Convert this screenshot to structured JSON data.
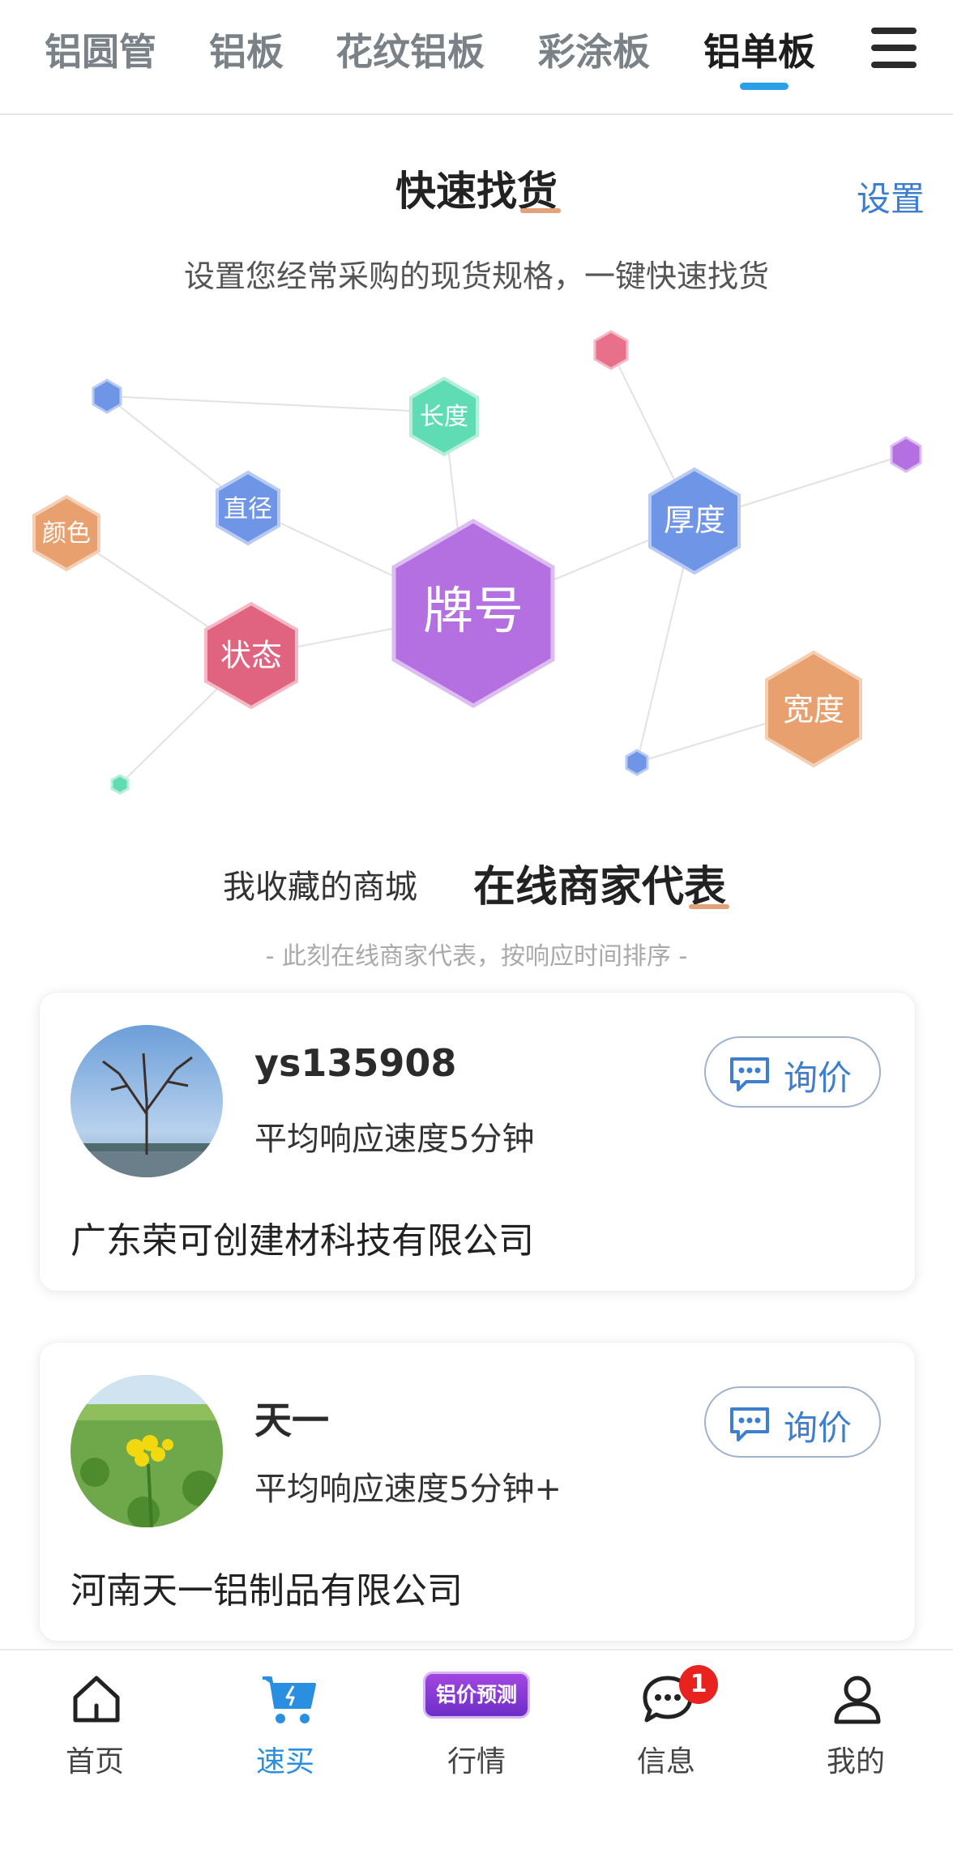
{
  "top_tabs": [
    "铝圆管",
    "铝板",
    "花纹铝板",
    "彩涂板",
    "铝单板"
  ],
  "active_tab_index": 4,
  "quick_find": {
    "title": "快速找货",
    "settings": "设置",
    "subtitle": "设置您经常采购的现货规格，一键快速找货"
  },
  "spec_nodes": [
    {
      "label": "牌号",
      "color": "#b46fe0"
    },
    {
      "label": "厚度",
      "color": "#6f95e6"
    },
    {
      "label": "状态",
      "color": "#e0637f"
    },
    {
      "label": "宽度",
      "color": "#e8a06e"
    },
    {
      "label": "直径",
      "color": "#6f95e6"
    },
    {
      "label": "长度",
      "color": "#5fdcb3"
    },
    {
      "label": "颜色",
      "color": "#e8a06e"
    }
  ],
  "merchants_section": {
    "tab_favorites": "我收藏的商城",
    "tab_online": "在线商家代表",
    "subtitle": "- 此刻在线商家代表，按响应时间排序 -"
  },
  "merchants": [
    {
      "name": "ys135908",
      "speed": "平均响应速度5分钟",
      "company": "广东荣可创建材科技有限公司",
      "inquire_label": "询价"
    },
    {
      "name": "天一",
      "speed": "平均响应速度5分钟+",
      "company": "河南天一铝制品有限公司",
      "inquire_label": "询价"
    }
  ],
  "bottom_nav": {
    "items": [
      {
        "label": "首页",
        "icon": "home-icon"
      },
      {
        "label": "速买",
        "icon": "cart-icon"
      },
      {
        "label": "行情",
        "icon": "price-prediction-badge",
        "badge_text": "铝价预测"
      },
      {
        "label": "信息",
        "icon": "chat-icon",
        "badge_count": "1"
      },
      {
        "label": "我的",
        "icon": "user-icon"
      }
    ],
    "active_index": 1
  },
  "colors": {
    "accent_blue": "#3e7ecf",
    "tab_indicator": "#2aa0e8",
    "active_nav": "#2a8fe0",
    "badge_red": "#e8231f"
  }
}
